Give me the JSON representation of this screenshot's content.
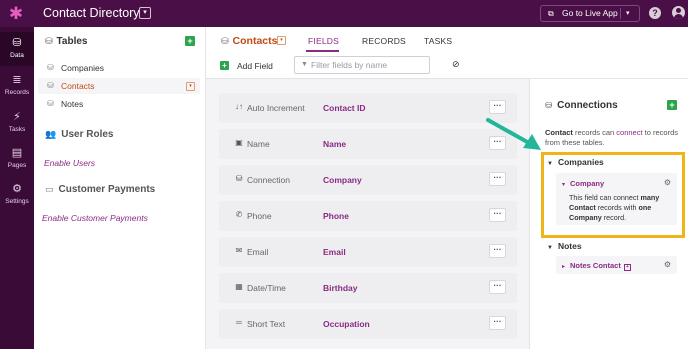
{
  "app": {
    "title": "Contact Directory",
    "live_button": "Go to Live App"
  },
  "left_nav": [
    {
      "label": "Data",
      "icon": "data-icon"
    },
    {
      "label": "Records",
      "icon": "records-icon"
    },
    {
      "label": "Tasks",
      "icon": "tasks-icon"
    },
    {
      "label": "Pages",
      "icon": "pages-icon"
    },
    {
      "label": "Settings",
      "icon": "settings-icon"
    }
  ],
  "tables_panel": {
    "heading": "Tables",
    "items": [
      "Companies",
      "Contacts",
      "Notes"
    ],
    "active_item": "Contacts",
    "user_roles": {
      "heading": "User Roles",
      "link": "Enable Users"
    },
    "payments": {
      "heading": "Customer Payments",
      "link": "Enable Customer Payments"
    }
  },
  "header": {
    "table_name": "Contacts",
    "tabs": [
      "FIELDS",
      "RECORDS",
      "TASKS"
    ],
    "active_tab": "FIELDS",
    "add_field_label": "Add Field",
    "filter_placeholder": "Filter fields by name"
  },
  "fields": [
    {
      "type": "Auto Increment",
      "name": "Contact ID",
      "icon": "increment-icon"
    },
    {
      "type": "Name",
      "name": "Name",
      "icon": "name-card-icon"
    },
    {
      "type": "Connection",
      "name": "Company",
      "icon": "connection-icon"
    },
    {
      "type": "Phone",
      "name": "Phone",
      "icon": "phone-icon"
    },
    {
      "type": "Email",
      "name": "Email",
      "icon": "email-icon"
    },
    {
      "type": "Date/Time",
      "name": "Birthday",
      "icon": "calendar-icon"
    },
    {
      "type": "Short Text",
      "name": "Occupation",
      "icon": "short-text-icon"
    }
  ],
  "more_label": "···",
  "connections": {
    "heading": "Connections",
    "desc_table": "Contact",
    "desc_middle": " records can ",
    "desc_link": "connect",
    "desc_end": " to records from these tables.",
    "groups": [
      {
        "name": "Companies",
        "card_name": "Company",
        "card_desc": {
          "p1": "This field can connect ",
          "b1": "many Contact",
          "p2": " records with ",
          "b2": "one Company",
          "p3": " record."
        }
      },
      {
        "name": "Notes",
        "card_name": "Notes Contact"
      }
    ]
  },
  "colors": {
    "brand": "#4b0f48",
    "accent": "#8a2b83",
    "active_table": "#c14a13",
    "add": "#2ea44f",
    "highlight": "#f0b418",
    "arrow": "#25b59a"
  }
}
